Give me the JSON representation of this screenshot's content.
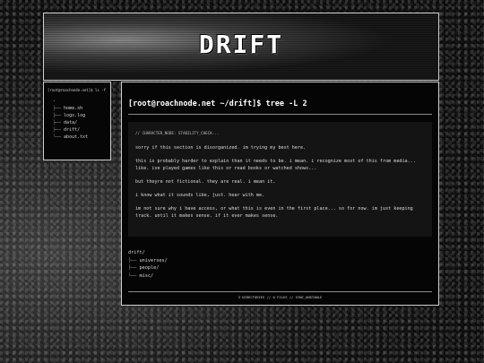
{
  "banner": {
    "title": "DRIFT"
  },
  "sidebar": {
    "command": "[root@roachnode.net]$ ls -f",
    "root": ".",
    "items": [
      {
        "branch": "├──",
        "label": "home.sh"
      },
      {
        "branch": "├──",
        "label": "logs.log"
      },
      {
        "branch": "├──",
        "label": "data/"
      },
      {
        "branch": "├──",
        "label": "drift/"
      },
      {
        "branch": "└──",
        "label": "about.txt"
      }
    ]
  },
  "main": {
    "prompt": "[root@roachnode.net ~/drift]$ tree -L 2",
    "box": {
      "header": "// CHARACTER_NODE: STABILITY_CHECK...",
      "paragraphs": [
        "sorry if this section is disorganized. im trying my best here.",
        "this is probably harder to explain than it needs to be. i mean. i recognize most of this from media... like. ive played games like this or read books or watched shows...",
        "but theyre not fictional. they are real. i mean it.",
        "i know what it sounds like, just. hear with me.",
        "im not sure why i have access, or what this is even in the first place... so for now. im just keeping track. until it makes sense. if it ever makes sense."
      ]
    },
    "tree": {
      "root": "drift/",
      "children": [
        {
          "branch": "├──",
          "label": "universes/"
        },
        {
          "branch": "├──",
          "label": "people/"
        },
        {
          "branch": "└──",
          "label": "misc/"
        }
      ]
    },
    "footer": "3 DIRECTORIES // 0 FILES // SYNC_UNSTABLE"
  }
}
